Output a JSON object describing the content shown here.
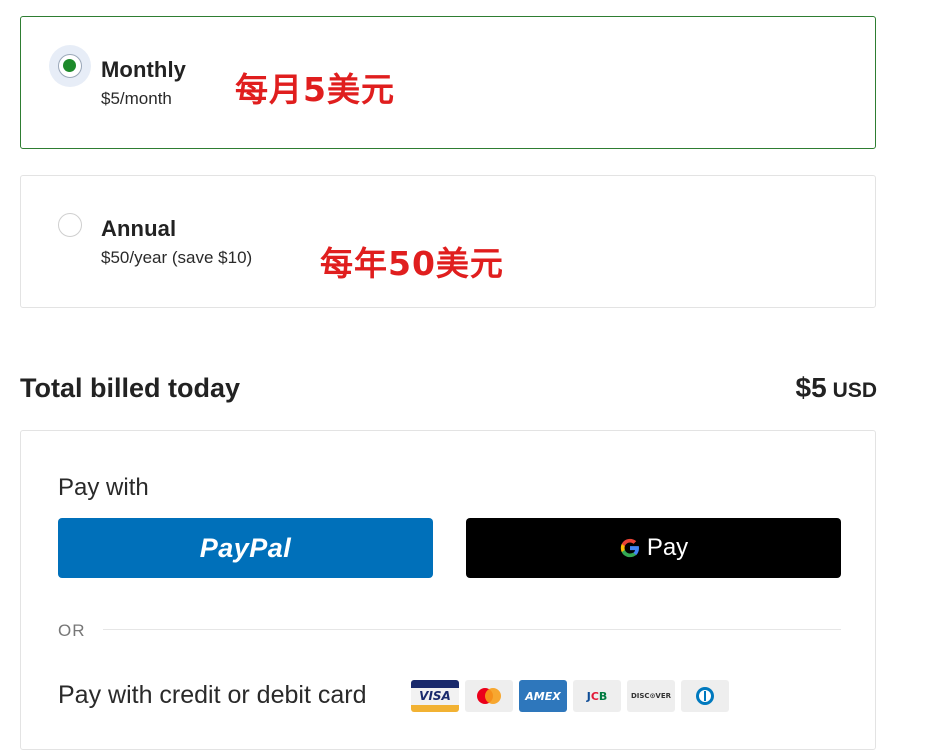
{
  "plans": [
    {
      "name": "Monthly",
      "price": "$5/month",
      "annotation": "每月5美元",
      "selected": true
    },
    {
      "name": "Annual",
      "price": "$50/year (save $10)",
      "annotation": "每年50美元",
      "selected": false
    }
  ],
  "total": {
    "label": "Total billed today",
    "amount": "$5",
    "currency": "USD"
  },
  "payment": {
    "pay_with": "Pay with",
    "paypal_label": "PayPal",
    "gpay_label": "Pay",
    "or_label": "OR",
    "card_label": "Pay with credit or debit card",
    "card_brands": {
      "visa": "VISA",
      "amex": "AMEX",
      "jcb": "JCB",
      "discover": "DISC⊙VER"
    }
  },
  "colors": {
    "selected_border": "#2e7d32",
    "radio_dot": "#1d8a2a",
    "annotation": "#e01e1e",
    "paypal": "#0070ba",
    "gpay": "#000000"
  }
}
